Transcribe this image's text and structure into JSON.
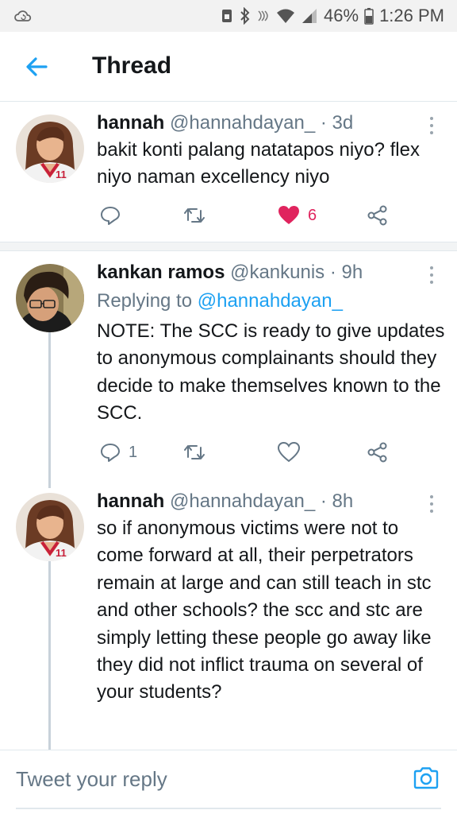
{
  "status_bar": {
    "battery_percent": "46%",
    "time": "1:26 PM",
    "icons": [
      "cloud-sync-icon",
      "silent-icon",
      "bluetooth-icon",
      "nfc-icon",
      "wifi-icon",
      "signal-icon",
      "battery-icon"
    ]
  },
  "header": {
    "title": "Thread",
    "back_icon": "arrow-left-icon"
  },
  "tweets": [
    {
      "name": "hannah",
      "handle": "@hannahdayan_",
      "time": "· 3d",
      "text": "bakit konti palang natatapos niyo? flex niyo naman excellency niyo",
      "reply_count": "",
      "retweet_count": "",
      "like_count": "6",
      "liked": true
    },
    {
      "name": "kankan ramos",
      "handle": "@kankunis",
      "time": "· 9h",
      "replying_label": "Replying to",
      "replying_handle": "@hannahdayan_",
      "text": "NOTE: The SCC is ready to give updates to anonymous complainants should they decide to make themselves known to the SCC.",
      "reply_count": "1",
      "retweet_count": "",
      "like_count": "",
      "liked": false
    },
    {
      "name": "hannah",
      "handle": "@hannahdayan_",
      "time": "· 8h",
      "text": "so if anonymous victims were not to come forward at all, their perpetrators remain at large and can still teach in stc and other schools? the scc and stc are simply letting these people go away like they did not inflict trauma on several of your students?"
    }
  ],
  "composer": {
    "placeholder": "Tweet your reply",
    "camera_icon": "camera-icon"
  },
  "colors": {
    "accent": "#1da1f2",
    "like": "#e0245e",
    "secondary_text": "#657786",
    "thread_line": "#c8d2da"
  }
}
